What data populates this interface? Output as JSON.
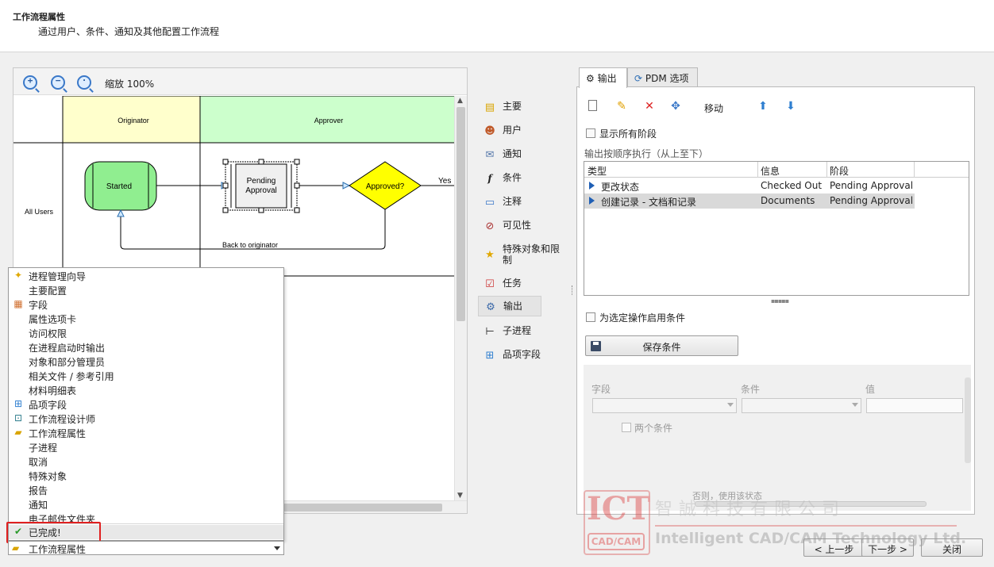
{
  "header": {
    "title": "工作流程属性",
    "subtitle": "通过用户、条件、通知及其他配置工作流程"
  },
  "zoom": {
    "label": "缩放 100%"
  },
  "diagram": {
    "lanes": [
      "Originator",
      "Approver"
    ],
    "row_label": "All Users",
    "states": {
      "started": "Started",
      "pending": "Pending Approval",
      "approved": "Approved?"
    },
    "transitions": {
      "yes": "Yes",
      "back": "Back to originator"
    },
    "colors": {
      "originator_lane": "#ffffcc",
      "approver_lane": "#ccffcc",
      "started_fill": "#90ee90",
      "approved_fill": "#ffff00"
    }
  },
  "mid_nav": [
    {
      "label": "主要",
      "icon": "main-properties-icon"
    },
    {
      "label": "用户",
      "icon": "users-icon"
    },
    {
      "label": "通知",
      "icon": "envelope-icon"
    },
    {
      "label": "条件",
      "icon": "function-icon"
    },
    {
      "label": "注释",
      "icon": "comment-icon"
    },
    {
      "label": "可见性",
      "icon": "visibility-icon"
    },
    {
      "label": "特殊对象和限制",
      "icon": "star-icon"
    },
    {
      "label": "任务",
      "icon": "task-icon"
    },
    {
      "label": "输出",
      "icon": "gear-icon"
    },
    {
      "label": "子进程",
      "icon": "subprocess-icon"
    },
    {
      "label": "品项字段",
      "icon": "item-fields-icon"
    }
  ],
  "right": {
    "tabs": [
      "输出",
      "PDM 选项"
    ],
    "move_label": "移动",
    "show_all_stages": "显示所有阶段",
    "order_note": "输出按顺序执行（从上至下）",
    "columns": [
      "类型",
      "信息",
      "阶段"
    ],
    "rows": [
      {
        "type": "更改状态",
        "info": "Checked Out",
        "stage": "Pending Approval"
      },
      {
        "type": "创建记录 - 文档和记录",
        "info": "Documents",
        "stage": "Pending Approval"
      }
    ],
    "enable_condition": "为选定操作启用条件",
    "save_condition": "保存条件",
    "cond_headers": [
      "字段",
      "条件",
      "值"
    ],
    "two_conditions": "两个条件",
    "otherwise": "否则，使用该状态"
  },
  "menu": {
    "items": [
      {
        "label": "进程管理向导",
        "icon": "wand-icon"
      },
      {
        "label": "主要配置",
        "icon": ""
      },
      {
        "label": "字段",
        "icon": "table-icon"
      },
      {
        "label": "属性选项卡",
        "icon": ""
      },
      {
        "label": "访问权限",
        "icon": ""
      },
      {
        "label": "在进程启动时输出",
        "icon": ""
      },
      {
        "label": "对象和部分管理员",
        "icon": ""
      },
      {
        "label": "相关文件 / 参考引用",
        "icon": ""
      },
      {
        "label": "材料明细表",
        "icon": ""
      },
      {
        "label": "品项字段",
        "icon": "item-fields-icon"
      },
      {
        "label": "工作流程设计师",
        "icon": "designer-icon"
      },
      {
        "label": "工作流程属性",
        "icon": "folder-icon"
      },
      {
        "label": "子进程",
        "icon": ""
      },
      {
        "label": "取消",
        "icon": ""
      },
      {
        "label": "特殊对象",
        "icon": ""
      },
      {
        "label": "报告",
        "icon": ""
      },
      {
        "label": "通知",
        "icon": ""
      },
      {
        "label": "电子邮件文件夹",
        "icon": ""
      },
      {
        "label": "已完成!",
        "icon": "checkmark-icon"
      }
    ],
    "current": "工作流程属性"
  },
  "buttons": {
    "back": "< 上一步",
    "next": "下一步 >",
    "close": "关闭"
  },
  "watermark": {
    "logo": "ICT",
    "logo_sub": "CAD/CAM",
    "cn": "智誠科技有限公司",
    "en": "Intelligent CAD/CAM Technology Ltd."
  }
}
